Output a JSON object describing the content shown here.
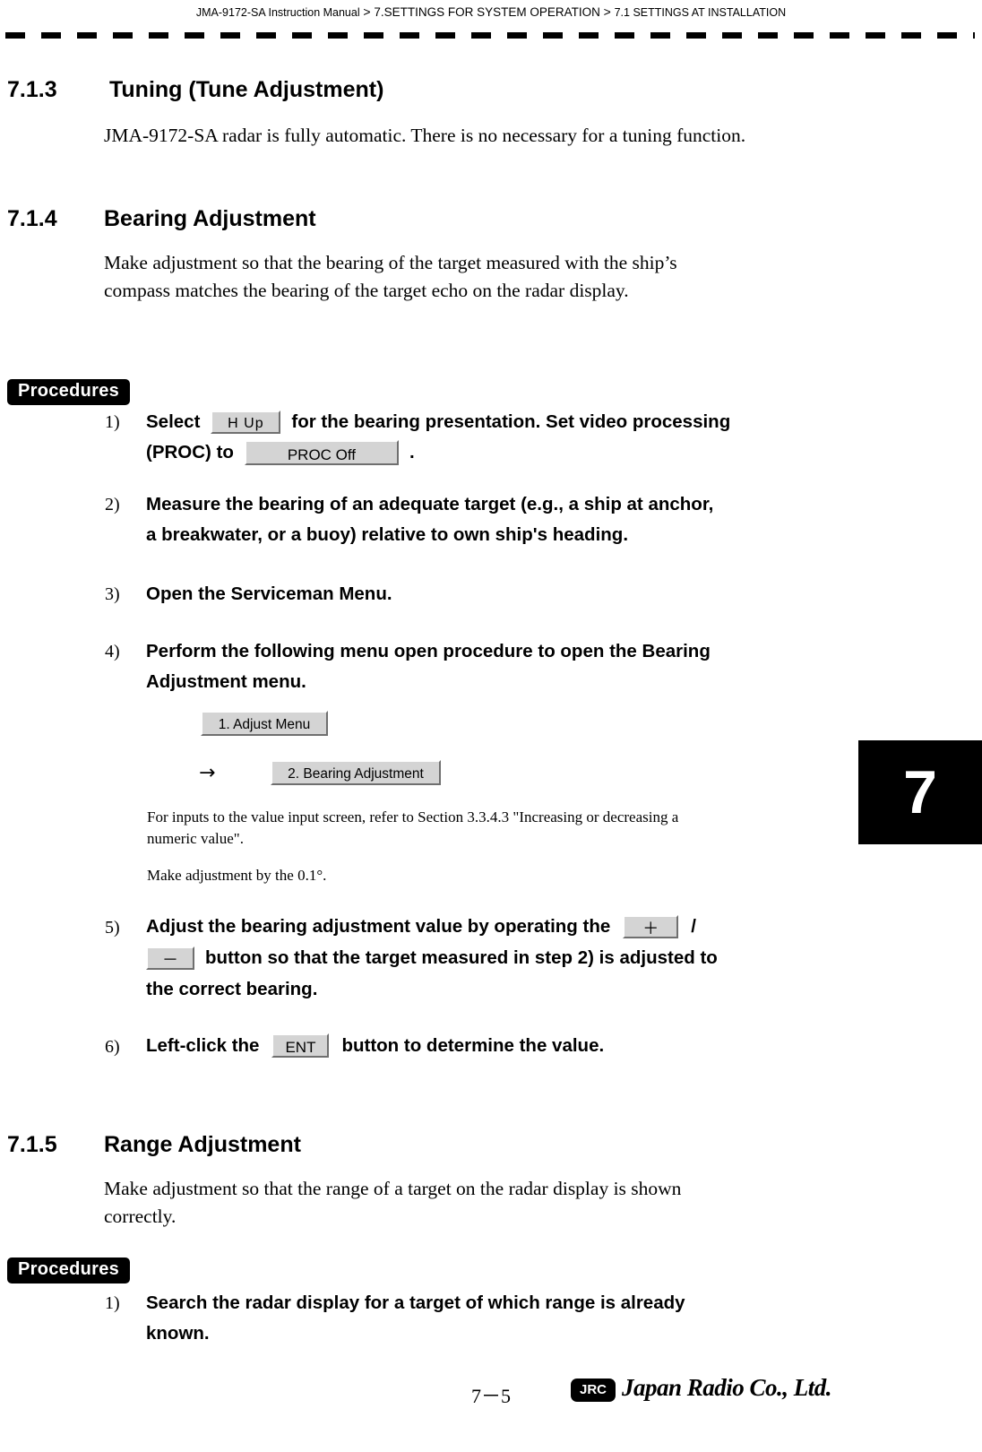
{
  "header": {
    "manual": "JMA-9172-SA Instruction Manual",
    "gt1": ">",
    "chapter": "7.SETTINGS FOR SYSTEM OPERATION",
    "gt2": ">",
    "section": "7.1  SETTINGS AT INSTALLATION"
  },
  "chapter_tab": "7",
  "sections": {
    "tuning": {
      "number": "7.1.3",
      "title": "Tuning (Tune Adjustment)",
      "body": "JMA-9172-SA radar is fully automatic. There is no necessary for a tuning function."
    },
    "bearing": {
      "number": "7.1.4",
      "title": "Bearing Adjustment",
      "body_line1": "Make adjustment so that the bearing of the target measured with the ship’s",
      "body_line2": "compass matches the bearing of the target echo on the radar display."
    },
    "range": {
      "number": "7.1.5",
      "title": "Range Adjustment",
      "body_line1": "Make adjustment so that the range of a target on the radar display is shown",
      "body_line2": "correctly."
    }
  },
  "procedures_label": "Procedures",
  "bearing_steps": {
    "s1": {
      "num": "1)",
      "part1": "Select",
      "key_hup": "H Up",
      "part2": "for the bearing presentation. Set video processing",
      "part3": "(PROC) to",
      "key_proc": "PROC Off",
      "part4": "."
    },
    "s2": {
      "num": "2)",
      "line1": "Measure the bearing of an adequate target (e.g., a ship at anchor,",
      "line2": "a breakwater, or a buoy) relative to own ship's heading."
    },
    "s3": {
      "num": "3)",
      "line1": "Open the Serviceman Menu."
    },
    "s4": {
      "num": "4)",
      "line1": "Perform the following menu open procedure to open the Bearing",
      "line2": "Adjustment menu.",
      "menu1": "1. Adjust Menu",
      "arrow": "→",
      "menu2": "2. Bearing Adjustment",
      "note1_line1": "For inputs to the value input screen, refer to Section 3.3.4.3 \"Increasing or decreasing a",
      "note1_line2": "numeric value\".",
      "note2": "Make adjustment by the 0.1°."
    },
    "s5": {
      "num": "5)",
      "part1": "Adjust the bearing adjustment value by operating the",
      "key_plus": "＋",
      "slash": "/",
      "key_minus": "－",
      "part2": "button so that the target measured in step 2) is adjusted to",
      "part3": "the correct bearing."
    },
    "s6": {
      "num": "6)",
      "part1": "Left-click the",
      "key_ent": "ENT",
      "part2": "button to determine the value."
    }
  },
  "range_steps": {
    "s1": {
      "num": "1)",
      "line1": "Search the radar display for a target of which range is already",
      "line2": "known."
    }
  },
  "footer": {
    "page": "7－5",
    "logo_text": "JRC",
    "company": "Japan Radio Co., Ltd."
  }
}
